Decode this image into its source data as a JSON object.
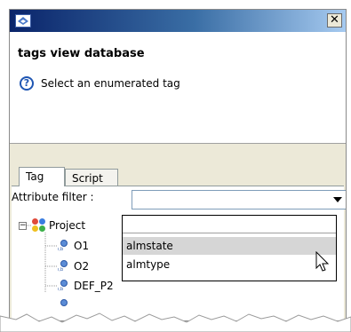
{
  "dialog": {
    "close_label": "✕",
    "title": "tags view database",
    "help_text": "Select an enumerated tag"
  },
  "tabs": [
    {
      "label": "Tag",
      "active": true
    },
    {
      "label": "Script",
      "active": false
    }
  ],
  "filter": {
    "label": "Attribute filter :",
    "value": "",
    "options": [
      "",
      "almstate",
      "almtype"
    ],
    "highlighted": "almstate"
  },
  "tree": {
    "root": "Project",
    "expand_symbol": "−",
    "items": [
      "O1",
      "O2",
      "DEF_P2"
    ]
  },
  "colors": {
    "titlebar_start": "#0a246a",
    "titlebar_end": "#a6caf0",
    "panel_bg": "#ece9d8",
    "highlight": "#d6d6d6"
  }
}
